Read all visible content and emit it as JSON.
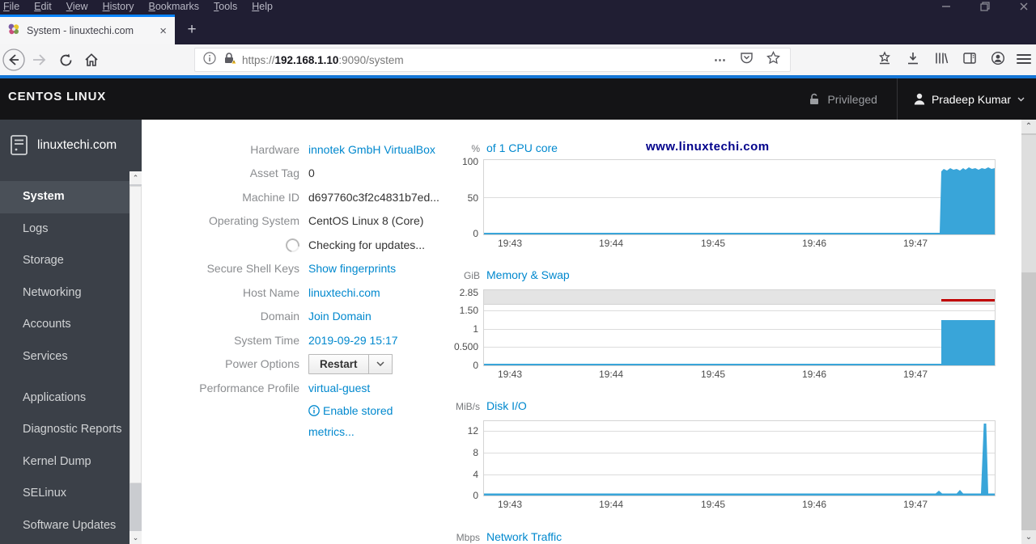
{
  "browser": {
    "menu": [
      "File",
      "Edit",
      "View",
      "History",
      "Bookmarks",
      "Tools",
      "Help"
    ],
    "tab": {
      "title": "System - linuxtechi.com",
      "close_glyph": "×"
    },
    "new_tab_glyph": "+",
    "url": {
      "scheme": "https://",
      "host": "192.168.1.10",
      "rest": ":9090/system"
    },
    "urlbar_dots_glyph": "⋯"
  },
  "header": {
    "brand": "CENTOS LINUX",
    "privileged_label": "Privileged",
    "user_name": "Pradeep Kumar"
  },
  "sidebar": {
    "host": "linuxtechi.com",
    "items": [
      {
        "label": "System",
        "active": true
      },
      {
        "label": "Logs",
        "active": false
      },
      {
        "label": "Storage",
        "active": false
      },
      {
        "label": "Networking",
        "active": false
      },
      {
        "label": "Accounts",
        "active": false
      },
      {
        "label": "Services",
        "active": false
      },
      {
        "label": "Applications",
        "active": false
      },
      {
        "label": "Diagnostic Reports",
        "active": false
      },
      {
        "label": "Kernel Dump",
        "active": false
      },
      {
        "label": "SELinux",
        "active": false
      },
      {
        "label": "Software Updates",
        "active": false
      }
    ]
  },
  "system_info": {
    "rows": [
      {
        "label": "Hardware",
        "value": "innotek GmbH VirtualBox",
        "type": "link"
      },
      {
        "label": "Asset Tag",
        "value": "0",
        "type": "text"
      },
      {
        "label": "Machine ID",
        "value": "d697760c3f2c4831b7ed...",
        "type": "text"
      },
      {
        "label": "Operating System",
        "value": "CentOS Linux 8 (Core)",
        "type": "text"
      },
      {
        "label": "",
        "value": "Checking for updates...",
        "type": "spinner"
      },
      {
        "label": "Secure Shell Keys",
        "value": "Show fingerprints",
        "type": "link"
      },
      {
        "label": "Host Name",
        "value": "linuxtechi.com",
        "type": "link"
      },
      {
        "label": "Domain",
        "value": "Join Domain",
        "type": "link"
      },
      {
        "label": "System Time",
        "value": "2019-09-29 15:17",
        "type": "link"
      },
      {
        "label": "Power Options",
        "value": "Restart",
        "type": "button"
      },
      {
        "label": "Performance Profile",
        "value": "virtual-guest",
        "type": "link"
      },
      {
        "label": "",
        "value": "Enable stored metrics...",
        "type": "info-link"
      }
    ]
  },
  "watermark": "www.linuxtechi.com",
  "charts": {
    "x_ticks": [
      "19:43",
      "19:44",
      "19:45",
      "19:46",
      "19:47"
    ],
    "cpu": {
      "unit": "%",
      "title": "of 1 CPU core",
      "y_ticks": [
        "100",
        "50",
        "0"
      ]
    },
    "memory": {
      "unit": "GiB",
      "title": "Memory & Swap",
      "y_ticks": [
        "2.85",
        "1.50",
        "1",
        "0.500",
        "0"
      ]
    },
    "disk": {
      "unit": "MiB/s",
      "title": "Disk I/O",
      "y_ticks": [
        "12",
        "8",
        "4",
        "0"
      ]
    },
    "network": {
      "unit": "Mbps",
      "title": "Network Traffic"
    }
  },
  "chart_data": [
    {
      "type": "area",
      "title": "CPU usage",
      "ylabel": "% of 1 CPU core",
      "ylim": [
        0,
        100
      ],
      "x_ticks": [
        "19:43",
        "19:44",
        "19:45",
        "19:46",
        "19:47"
      ],
      "x": [
        "19:43",
        "19:44",
        "19:45",
        "19:46",
        "19:47",
        "19:47:20",
        "19:47:25",
        "19:48:00"
      ],
      "values": [
        1,
        1,
        1,
        1,
        1,
        1,
        91,
        91
      ],
      "note": "flat near 0 until ~19:47:20 then sustained ~90-93% with jagged top until right edge"
    },
    {
      "type": "area",
      "title": "Memory & Swap",
      "ylabel": "GiB",
      "ylim": [
        0,
        3.17
      ],
      "x_ticks": [
        "19:43",
        "19:44",
        "19:45",
        "19:46",
        "19:47"
      ],
      "series": [
        {
          "name": "memory-used",
          "x": [
            "19:43",
            "19:47:20",
            "19:47:25",
            "19:48:00"
          ],
          "values": [
            0.03,
            0.03,
            1.22,
            1.22
          ],
          "color": "#39a5d9"
        },
        {
          "name": "swap-used",
          "x": [
            "19:47:20",
            "19:48:00"
          ],
          "values": [
            2.3,
            2.3
          ],
          "color": "#cc0000"
        },
        {
          "name": "total-memory-line",
          "value": 2.85
        }
      ]
    },
    {
      "type": "area",
      "title": "Disk I/O",
      "ylabel": "MiB/s",
      "ylim": [
        0,
        13.5
      ],
      "x_ticks": [
        "19:43",
        "19:44",
        "19:45",
        "19:46",
        "19:47"
      ],
      "x": [
        "19:43",
        "19:47:15",
        "19:47:30",
        "19:47:55",
        "19:48:00"
      ],
      "values": [
        0.05,
        0.5,
        0.7,
        13.2,
        0.1
      ],
      "note": "flat near 0 with two tiny bumps after 19:47 and one tall spike ~13 MiB/s at right edge"
    },
    {
      "type": "area",
      "title": "Network Traffic",
      "ylabel": "Mbps",
      "note": "only the header is visible; plot cut off below viewport"
    }
  ],
  "colors": {
    "link_blue": "#0088ce",
    "chart_fill_blue": "#39a5d9",
    "swap_red": "#c00000",
    "tab_stripe_blue": "#0a84ff",
    "watermark_blue": "#00008b",
    "titlebar_navy": "#201e33",
    "sidebar_gray": "#3b4048",
    "header_black": "#141416"
  }
}
